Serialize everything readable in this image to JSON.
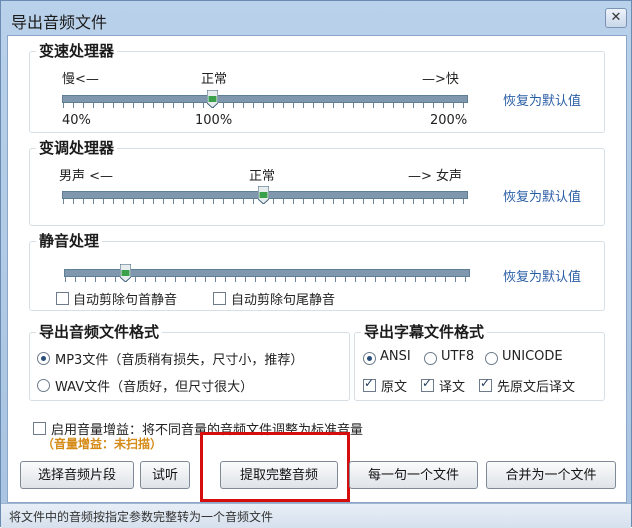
{
  "window": {
    "title": "导出音频文件",
    "close_glyph": "✕"
  },
  "speed": {
    "title": "变速处理器",
    "label_slow": "慢<—",
    "label_normal": "正常",
    "label_fast": "—>快",
    "scale_min": "40%",
    "scale_mid": "100%",
    "scale_max": "200%",
    "reset": "恢复为默认值",
    "value_percent": 100
  },
  "pitch": {
    "title": "变调处理器",
    "label_male": "男声 <—",
    "label_normal": "正常",
    "label_female": "—> 女声",
    "reset": "恢复为默认值"
  },
  "silence": {
    "title": "静音处理",
    "reset": "恢复为默认值",
    "trim_start": {
      "label": "自动剪除句首静音",
      "checked": false
    },
    "trim_end": {
      "label": "自动剪除句尾静音",
      "checked": false
    }
  },
  "audio_format": {
    "title": "导出音频文件格式",
    "options": [
      {
        "label": "MP3文件（音质稍有损失，尺寸小，推荐）",
        "selected": true
      },
      {
        "label": "WAV文件（音质好，但尺寸很大）",
        "selected": false
      }
    ]
  },
  "subtitle_format": {
    "title": "导出字幕文件格式",
    "encodings": [
      {
        "label": "ANSI",
        "selected": true
      },
      {
        "label": "UTF8",
        "selected": false
      },
      {
        "label": "UNICODE",
        "selected": false
      }
    ],
    "content": [
      {
        "label": "原文",
        "checked": true
      },
      {
        "label": "译文",
        "checked": true
      },
      {
        "label": "先原文后译文",
        "checked": true
      }
    ]
  },
  "volume_gain": {
    "label": "启用音量增益：将不同音量的音频文件调整为标准音量",
    "checked": false,
    "status": "（音量增益：未扫描）"
  },
  "buttons": {
    "select_segment": "选择音频片段",
    "preview": "试听",
    "extract_full": "提取完整音频",
    "per_sentence": "每一句一个文件",
    "merge_one": "合并为一个文件"
  },
  "status_bar": {
    "text": "将文件中的音频按指定参数完整转为一个音频文件"
  },
  "colors": {
    "highlight": "#d60d0d",
    "link": "#2b5fa5",
    "warning": "#d58a16"
  }
}
